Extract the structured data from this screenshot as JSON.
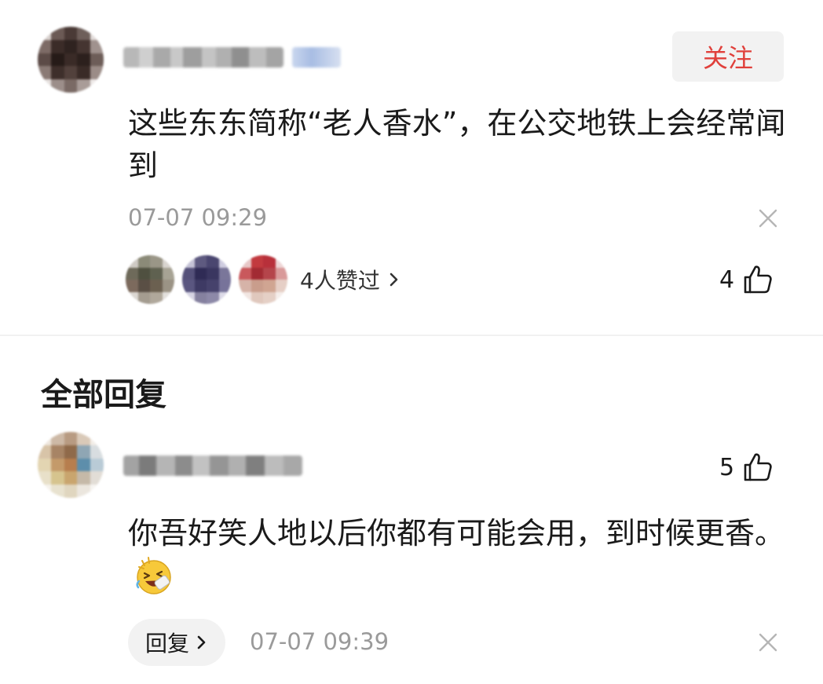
{
  "main_comment": {
    "follow_label": "关注",
    "text": "这些东东简称“老人香水”，在公交地铁上会经常闻到",
    "time": "07-07 09:29",
    "liked_by_text": "4人赞过",
    "like_count": "4"
  },
  "replies_section": {
    "title": "全部回复"
  },
  "reply": {
    "like_count": "5",
    "text": "你吾好笑人地以后你都有可能会用，到时候更香。",
    "reply_button_label": "回复",
    "time": "07-07 09:39"
  },
  "icons": {
    "close": "close-icon",
    "thumb": "thumbs-up-icon",
    "chevron": "chevron-right-icon",
    "emoji": "laughing-emoji-icon"
  },
  "colors": {
    "accent": "#e0403b",
    "meta_gray": "#9a9a9a",
    "button_bg": "#f2f2f2"
  }
}
